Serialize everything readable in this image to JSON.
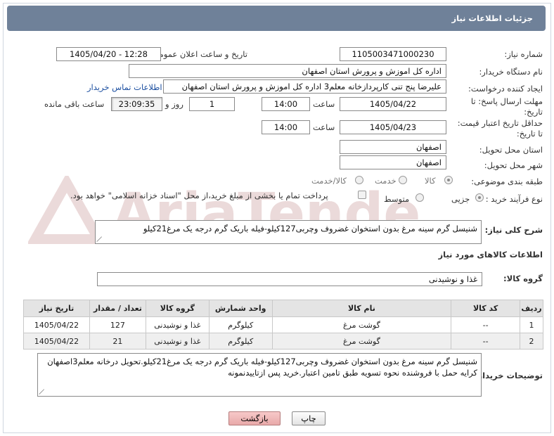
{
  "header": {
    "title": "جزئیات اطلاعات نیاز"
  },
  "fields": {
    "need_number_label": "شماره نیاز:",
    "need_number": "1105003471000230",
    "announce_label": "تاریخ و ساعت اعلان عمومی:",
    "announce_value": "1405/04/20 - 12:28",
    "buyer_org_label": "نام دستگاه خریدار:",
    "buyer_org": "اداره کل اموزش و پرورش استان اصفهان",
    "creator_label": "ایجاد کننده درخواست:",
    "creator": "علیرضا پنج تنی کارپردازخانه معلم3 اداره کل اموزش و پرورش استان اصفهان",
    "contact_link": "اطلاعات تماس خریدار",
    "deadline_label_1": "مهلت ارسال پاسخ: تا",
    "deadline_label_2": "تاریخ:",
    "deadline_date": "1405/04/22",
    "time_label": "ساعت",
    "deadline_time": "14:00",
    "days_value": "1",
    "days_label": "روز و",
    "remaining_time": "23:09:35",
    "remaining_label": "ساعت باقی مانده",
    "validity_label_1": "حداقل تاریخ اعتبار قیمت:",
    "validity_label_2": "تا تاریخ:",
    "validity_date": "1405/04/23",
    "validity_time": "14:00",
    "province_label": "استان محل تحویل:",
    "province": "اصفهان",
    "city_label": "شهر محل تحویل:",
    "city": "اصفهان",
    "category_label": "طبقه بندی موضوعی:",
    "category_options": [
      "کالا",
      "خدمت",
      "کالا/خدمت"
    ],
    "process_label": "نوع فرآیند خرید :",
    "process_options": [
      "جزیی",
      "متوسط"
    ],
    "payment_note": "پرداخت تمام یا بخشی از مبلغ خرید،از محل \"اسناد خزانه اسلامی\" خواهد بود."
  },
  "description": {
    "label": "شرح کلی نیاز:",
    "text": "شنیسل گرم سینه مرغ بدون استخوان غضروف وچربی127کیلو-فیله باریک گرم درجه یک مرغ21کیلو"
  },
  "goods": {
    "section_title": "اطلاعات کالاهای مورد نیاز",
    "group_label": "گروه کالا:",
    "group_value": "غذا و نوشیدنی",
    "columns": [
      "ردیف",
      "کد کالا",
      "نام کالا",
      "واحد شمارش",
      "گروه کالا",
      "تعداد / مقدار",
      "تاریخ نیاز"
    ],
    "rows": [
      [
        "1",
        "--",
        "گوشت مرغ",
        "کیلوگرم",
        "غذا و نوشیدنی",
        "127",
        "1405/04/22"
      ],
      [
        "2",
        "--",
        "گوشت مرغ",
        "کیلوگرم",
        "غذا و نوشیدنی",
        "21",
        "1405/04/22"
      ]
    ]
  },
  "buyer_notes": {
    "label": "توضیحات خریدار:",
    "text": "شنیسل گرم سینه مرغ بدون استخوان غضروف وچربی127کیلو-فیله باریک گرم درجه یک مرغ21کیلو.تحویل درخانه معلم3اصفهان کرایه حمل با فروشنده نحوه تسویه طبق تامین اعتبار.خرید پس ازتاییدنمونه"
  },
  "buttons": {
    "print": "چاپ",
    "back": "بازگشت"
  },
  "watermark": {
    "text": "AriaTender.net"
  },
  "colors": {
    "header_bg": "#6f8199",
    "link": "#1c4fa0",
    "back_button": "#e8a9a9"
  }
}
